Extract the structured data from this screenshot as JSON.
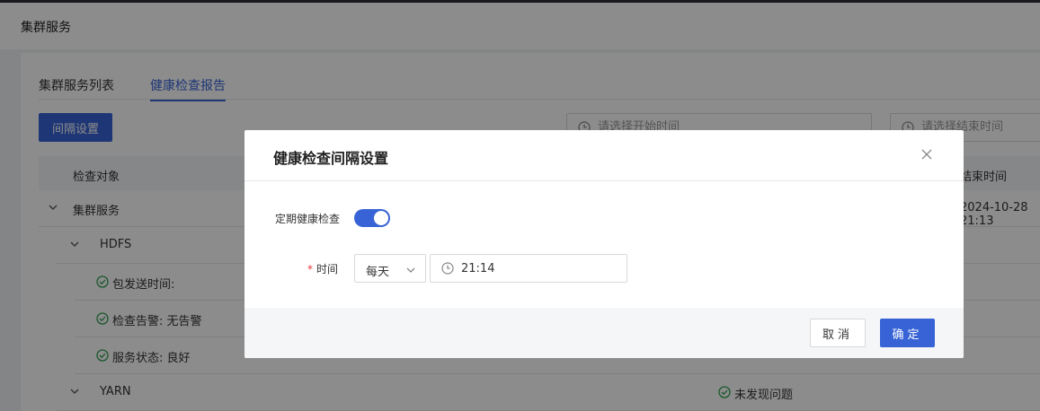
{
  "page": {
    "title": "集群服务"
  },
  "tabs": [
    {
      "label": "集群服务列表",
      "active": false
    },
    {
      "label": "健康检查报告",
      "active": true
    }
  ],
  "toolbar": {
    "interval_button": "间隔设置",
    "start_time_placeholder": "请选择开始时间",
    "end_time_placeholder": "请选择结束时间"
  },
  "table": {
    "headers": {
      "target": "检查对象",
      "end_time": "结束时间"
    },
    "rows": [
      {
        "label": "集群服务",
        "level": 0,
        "expand": true,
        "right": "2024-10-28 21:13"
      },
      {
        "label": "HDFS",
        "level": 1,
        "expand": true,
        "right": ""
      },
      {
        "label": "包发送时间:",
        "level": 2,
        "ok": true,
        "right": ""
      },
      {
        "label": "检查告警:  无告警",
        "level": 2,
        "ok": true,
        "right": ""
      },
      {
        "label": "服务状态:  良好",
        "level": 2,
        "ok": true,
        "right": ""
      },
      {
        "label": "YARN",
        "level": 1,
        "expand": true,
        "right": "",
        "status": "未发现问题"
      }
    ]
  },
  "modal": {
    "title": "健康检查间隔设置",
    "periodic_label": "定期健康检查",
    "periodic_enabled": true,
    "time_label": "时间",
    "frequency": "每天",
    "time_value": "21:14",
    "cancel_label": "取消",
    "confirm_label": "确定"
  },
  "colors": {
    "primary": "#3763d6",
    "success": "#2e9e4f",
    "required": "#e4393c"
  }
}
